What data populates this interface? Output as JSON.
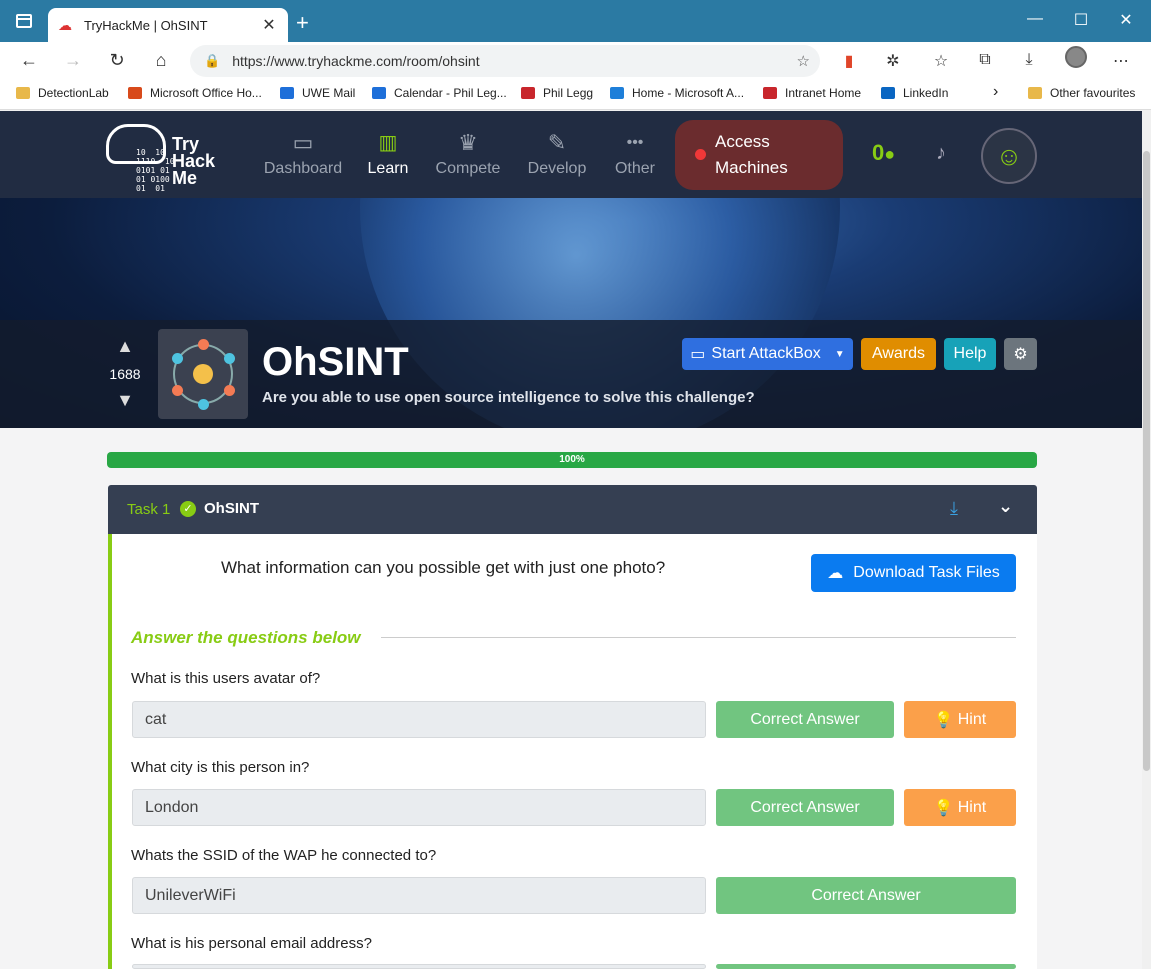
{
  "browser": {
    "tab_title": "TryHackMe | OhSINT",
    "tab_close": "✕",
    "new_tab": "+",
    "url": "https://www.tryhackme.com/room/ohsint",
    "window_controls": {
      "minimize": "—",
      "maximize": "☐",
      "close": "✕"
    }
  },
  "bookmarks": [
    {
      "label": "DetectionLab",
      "color": "#e8b84a"
    },
    {
      "label": "Microsoft Office Ho...",
      "color": "#d84a1b"
    },
    {
      "label": "UWE Mail",
      "color": "#1e6fd9"
    },
    {
      "label": "Calendar - Phil Leg...",
      "color": "#1e6fd9"
    },
    {
      "label": "Phil Legg",
      "color": "#c8262c"
    },
    {
      "label": "Home - Microsoft A...",
      "color": "#1e7fd9"
    },
    {
      "label": "Intranet Home",
      "color": "#c8262c"
    },
    {
      "label": "LinkedIn",
      "color": "#0a66c2"
    },
    {
      "label": "Other favourites",
      "color": "#e8b84a"
    }
  ],
  "thm_nav": {
    "logo_text": [
      "Try",
      "Hack",
      "Me"
    ],
    "logo_bits": "10  10\n1110  10\n0101 01\n01 0100\n01  01",
    "items": [
      {
        "label": "Dashboard",
        "icon": "▭"
      },
      {
        "label": "Learn",
        "icon": "📖"
      },
      {
        "label": "Compete",
        "icon": "🏆"
      },
      {
        "label": "Develop",
        "icon": "✎"
      },
      {
        "label": "Other",
        "icon": "•••"
      }
    ],
    "access_line1": "Access",
    "access_line2": "Machines",
    "streak": "0",
    "streak_icon": "🔥",
    "bell_icon": "🔔"
  },
  "room": {
    "upvote_icon": "👍",
    "downvote_icon": "👎",
    "votes": "1688",
    "title": "OhSINT",
    "subtitle": "Are you able to use open source intelligence to solve this challenge?",
    "start_attackbox": "Start AttackBox",
    "awards": "Awards",
    "help": "Help",
    "settings_icon": "⚙"
  },
  "progress": {
    "label": "100%",
    "value": 1.0
  },
  "task": {
    "number": "Task 1",
    "name": "OhSINT",
    "intro": "What information can you possible get with just one photo?",
    "download_label": "Download Task Files",
    "answers_heading": "Answer the questions below",
    "correct_label": "Correct Answer",
    "hint_label": "Hint",
    "questions": [
      {
        "question": "What is this users avatar of?",
        "answer": "cat",
        "has_hint": true
      },
      {
        "question": "What city is this person in?",
        "answer": "London",
        "has_hint": true
      },
      {
        "question": "Whats the SSID of the WAP he connected to?",
        "answer": "UnileverWiFi",
        "has_hint": false
      },
      {
        "question": "What is his personal email address?",
        "answer": "",
        "has_hint": false
      }
    ]
  }
}
